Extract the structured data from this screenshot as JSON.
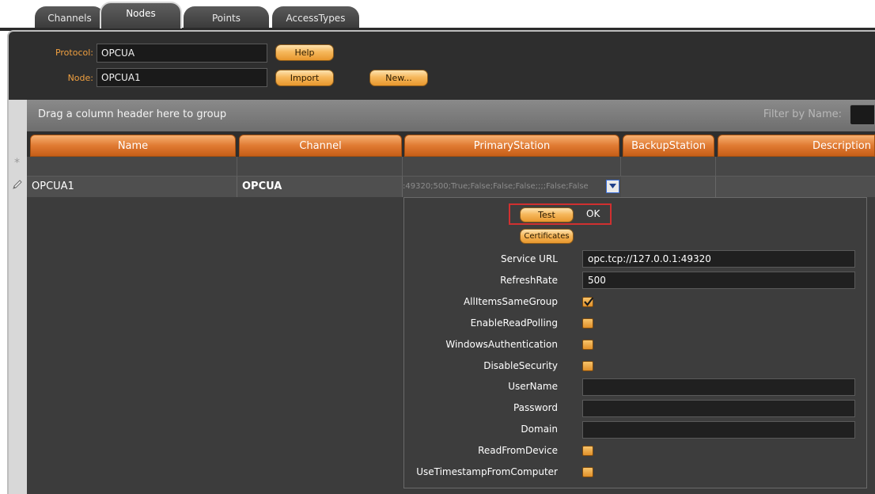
{
  "tabs": [
    {
      "label": "Channels",
      "active": false
    },
    {
      "label": "Nodes",
      "active": true
    },
    {
      "label": "Points",
      "active": false
    },
    {
      "label": "AccessTypes",
      "active": false
    }
  ],
  "top_form": {
    "protocol_label": "Protocol:",
    "protocol_value": "OPCUA",
    "node_label": "Node:",
    "node_value": "OPCUA1",
    "help_label": "Help",
    "import_label": "Import",
    "new_label": "New..."
  },
  "grid": {
    "group_hint": "Drag a column header here to group",
    "filter_label": "Filter by Name:",
    "columns": [
      "Name",
      "Channel",
      "PrimaryStation",
      "BackupStation",
      "Description"
    ],
    "new_row_marker": "*",
    "rows": [
      {
        "name": "OPCUA1",
        "channel": "OPCUA",
        "primary_station": ":49320;500;True;False;False;False;;;;False;False"
      }
    ]
  },
  "editor": {
    "test_label": "Test",
    "status": "OK",
    "certificates_label": "Certificates",
    "fields": [
      {
        "label": "Service URL",
        "type": "text",
        "value": "opc.tcp://127.0.0.1:49320"
      },
      {
        "label": "RefreshRate",
        "type": "text",
        "value": "500"
      },
      {
        "label": "AllItemsSameGroup",
        "type": "checkbox",
        "checked": true
      },
      {
        "label": "EnableReadPolling",
        "type": "checkbox",
        "checked": false
      },
      {
        "label": "WindowsAuthentication",
        "type": "checkbox",
        "checked": false
      },
      {
        "label": "DisableSecurity",
        "type": "checkbox",
        "checked": false
      },
      {
        "label": "UserName",
        "type": "text",
        "value": ""
      },
      {
        "label": "Password",
        "type": "text",
        "value": ""
      },
      {
        "label": "Domain",
        "type": "text",
        "value": ""
      },
      {
        "label": "ReadFromDevice",
        "type": "checkbox",
        "checked": false
      },
      {
        "label": "UseTimestampFromComputer",
        "type": "checkbox",
        "checked": false
      }
    ]
  },
  "colors": {
    "accent_orange": "#e07a32",
    "panel_dark": "#2e2e2e",
    "highlight_red": "#d03030"
  }
}
